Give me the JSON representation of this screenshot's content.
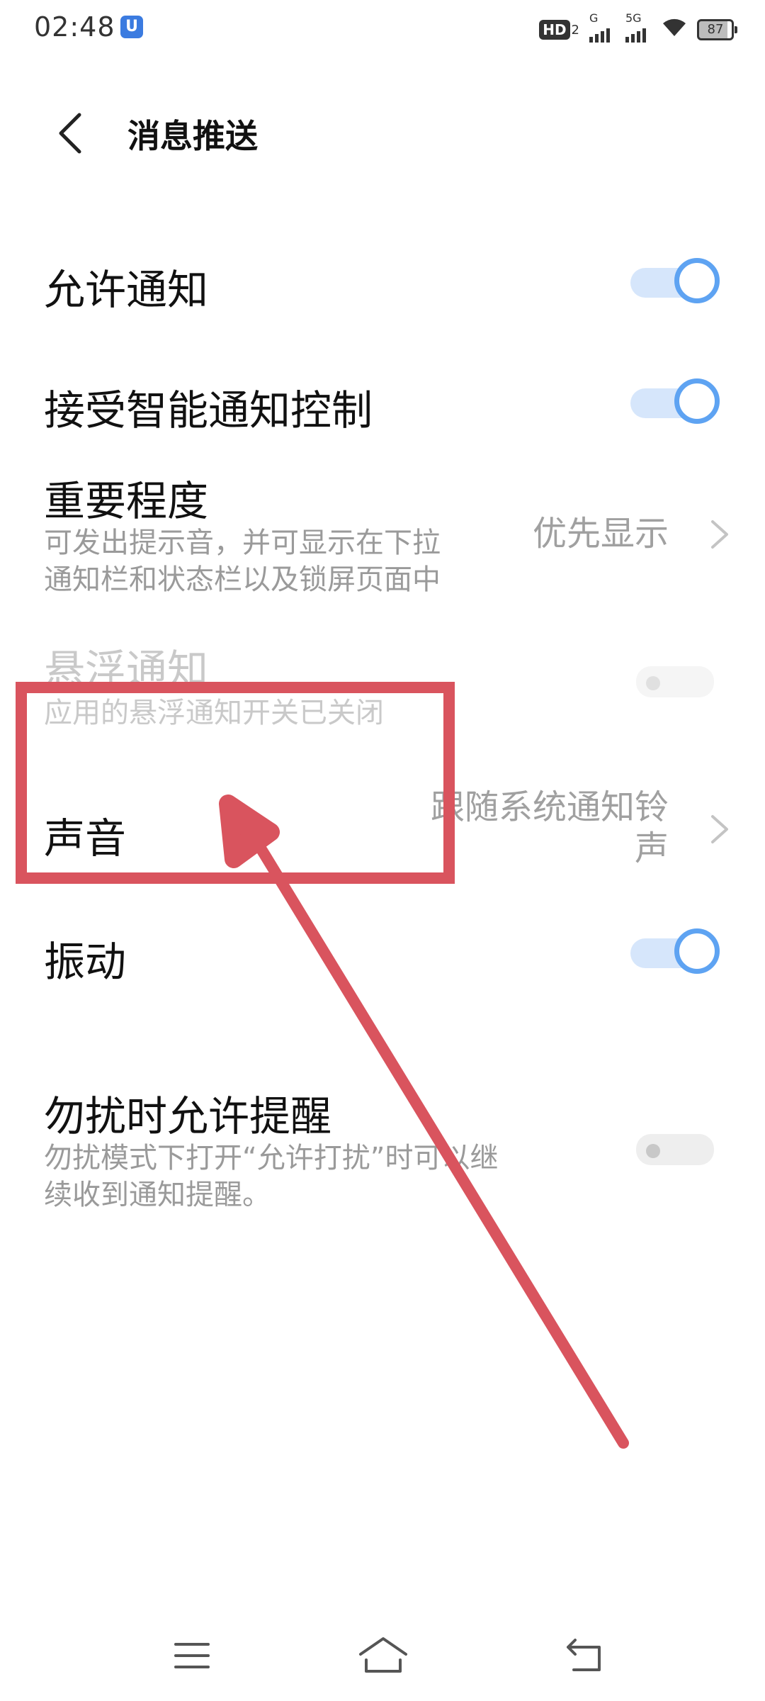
{
  "status_bar": {
    "time": "02:48",
    "alarm_glyph": "U",
    "hd_badge": "HD",
    "hd_sub": "2",
    "signal1_label": "G",
    "signal2_label": "5G",
    "battery_level": "87"
  },
  "header": {
    "title": "消息推送"
  },
  "settings": {
    "allow_notifications": {
      "title": "允许通知",
      "state": "on"
    },
    "smart_notification": {
      "title": "接受智能通知控制",
      "state": "on"
    },
    "importance": {
      "title": "重要程度",
      "desc_line1": "可发出提示音，并可显示在下拉",
      "desc_line2": "通知栏和状态栏以及锁屏页面中",
      "value": "优先显示"
    },
    "floating": {
      "title": "悬浮通知",
      "desc": "应用的悬浮通知开关已关闭",
      "state": "off-disabled"
    },
    "sound": {
      "title": "声音",
      "value_line1": "跟随系统通知铃",
      "value_line2": "声"
    },
    "vibration": {
      "title": "振动",
      "state": "on"
    },
    "dnd_reminder": {
      "title": "勿扰时允许提醒",
      "desc_line1": "勿扰模式下打开“允许打扰”时可以继",
      "desc_line2": "续收到通知提醒。",
      "state": "off"
    }
  },
  "colors": {
    "toggle_on": "#5ea3f2",
    "toggle_track_on": "#d6e6fb",
    "annotation_red": "#d9545e"
  }
}
